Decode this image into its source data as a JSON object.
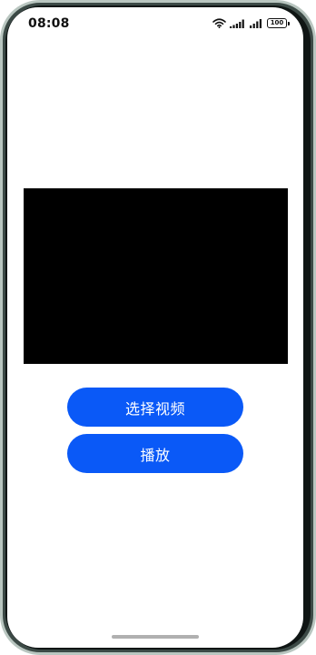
{
  "status_bar": {
    "time": "08:08",
    "battery_level": "100",
    "icons": [
      "wifi-icon",
      "signal-icon",
      "signal-icon",
      "battery-icon"
    ]
  },
  "player": {
    "background_color": "#000000"
  },
  "buttons": {
    "select_video_label": "选择视频",
    "play_label": "播放",
    "color": "#0a59f7"
  }
}
